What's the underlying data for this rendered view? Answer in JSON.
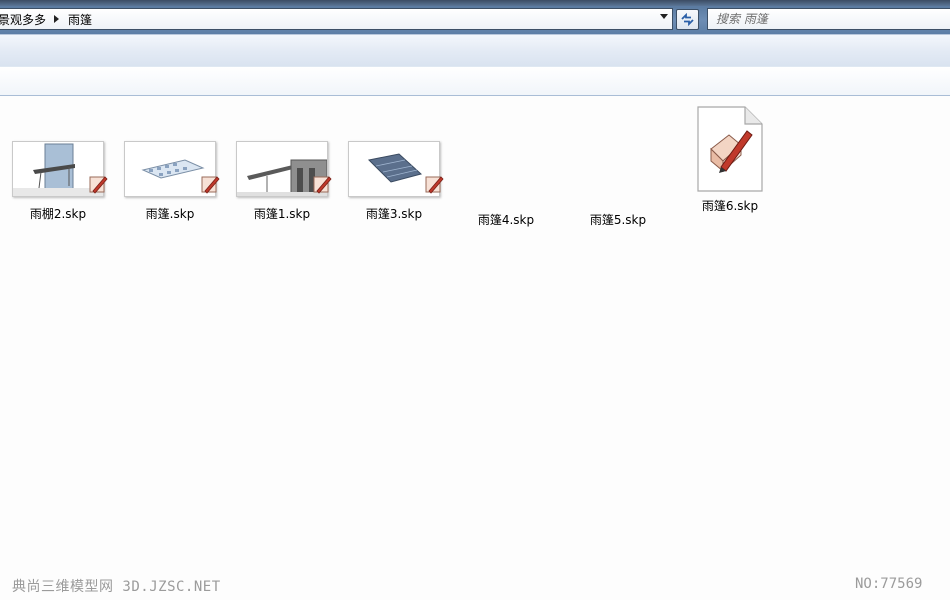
{
  "address_bar": {
    "breadcrumbs": [
      "景观多多",
      "雨篷"
    ]
  },
  "search": {
    "placeholder": "搜索 雨篷"
  },
  "files": [
    {
      "name": "雨棚2.skp",
      "icon": "sketchup-thumbnail-canopy-glass"
    },
    {
      "name": "雨篷.skp",
      "icon": "sketchup-thumbnail-canopy-frame"
    },
    {
      "name": "雨篷1.skp",
      "icon": "sketchup-thumbnail-canopy-building"
    },
    {
      "name": "雨篷3.skp",
      "icon": "sketchup-thumbnail-canopy-panel"
    },
    {
      "name": "雨篷4.skp",
      "icon": "none"
    },
    {
      "name": "雨篷5.skp",
      "icon": "none"
    },
    {
      "name": "雨篷6.skp",
      "icon": "sketchup-document-icon"
    }
  ],
  "watermark": {
    "left": "典尚三维模型网 3D.JZSC.NET",
    "right": "NO:77569"
  },
  "colors": {
    "address_bar_gradient": "#6d8db4",
    "sketchup_red": "#c0392b",
    "watermark": "#9b9b9b"
  }
}
